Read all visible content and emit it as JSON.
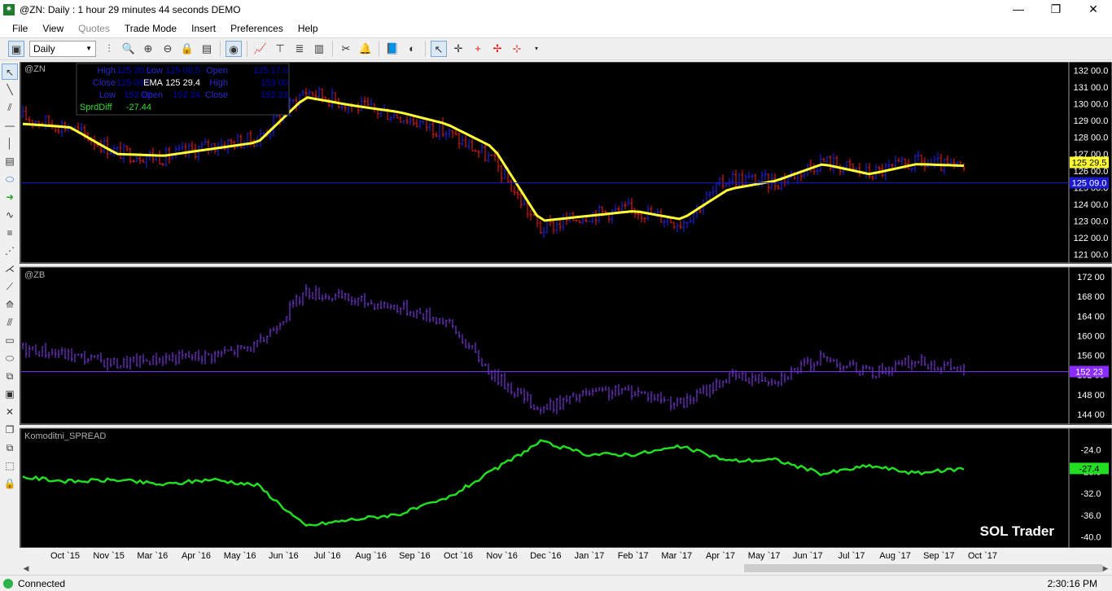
{
  "window": {
    "title": "@ZN: Daily : 1 hour 29 minutes 44 seconds DEMO",
    "min_glyph": "—",
    "max_glyph": "❐",
    "close_glyph": "✕"
  },
  "menu": [
    "File",
    "View",
    "Quotes",
    "Trade Mode",
    "Insert",
    "Preferences",
    "Help"
  ],
  "toolbar": {
    "interval": "Daily"
  },
  "data_window": {
    "rows": [
      [
        "High",
        "125 20.0",
        "Low",
        "125 06.5",
        "Open",
        "125 17.0"
      ],
      [
        "Close",
        "125 09.0",
        "EMA",
        "125 29.4",
        "High",
        "153 00"
      ],
      [
        "Low",
        "152 12",
        "Open",
        "152 24",
        "Close",
        "152 23"
      ],
      [
        "SprdDiff",
        "-27.44"
      ]
    ]
  },
  "panels": {
    "zn": {
      "label": "@ZN",
      "axis_ticks": [
        "132 00.0",
        "131 00.0",
        "130 00.0",
        "129 00.0",
        "128 00.0",
        "127 00.0",
        "126 00.0",
        "125 00.0",
        "124 00.0",
        "123 00.0",
        "122 00.0",
        "121 00.0"
      ],
      "ema_tag": "125 29.5",
      "price_tag": "125 09.0"
    },
    "zb": {
      "label": "@ZB",
      "axis_ticks": [
        "172 00",
        "168 00",
        "164 00",
        "160 00",
        "156 00",
        "152 00",
        "148 00",
        "144 00"
      ],
      "price_tag": "152 23"
    },
    "spread": {
      "label": "Komoditni_SPREAD",
      "axis_ticks": [
        "-24.0",
        "-28.0",
        "-32.0",
        "-36.0",
        "-40.0"
      ],
      "value_tag": "-27.4",
      "watermark": "SOL Trader"
    }
  },
  "x_axis": [
    "Oct `15",
    "Nov `15",
    "Mar `16",
    "Apr `16",
    "May `16",
    "Jun `16",
    "Jul `16",
    "Aug `16",
    "Sep `16",
    "Oct `16",
    "Nov `16",
    "Dec `16",
    "Jan `17",
    "Feb `17",
    "Mar `17",
    "Apr `17",
    "May `17",
    "Jun `17",
    "Jul `17",
    "Aug `17",
    "Sep `17",
    "Oct `17"
  ],
  "status": {
    "connection": "Connected",
    "clock": "2:30:16 PM"
  },
  "colors": {
    "bg": "#000000",
    "up_bar": "#2222ff",
    "down_bar": "#ff1a1a",
    "ema": "#ffff33",
    "zb_bar": "#8a3cff",
    "spread": "#22dd22",
    "hline": "#1a1acc"
  },
  "chart_data": [
    {
      "type": "line",
      "panel": "@ZN",
      "x": [
        "Oct `15",
        "Nov `15",
        "Mar `16",
        "Apr `16",
        "May `16",
        "Jun `16",
        "Jul `16",
        "Aug `16",
        "Sep `16",
        "Oct `16",
        "Nov `16",
        "Dec `16",
        "Jan `17",
        "Feb `17",
        "Mar `17",
        "Apr `17",
        "May `17",
        "Jun `17",
        "Jul `17",
        "Aug `17",
        "Sep `17"
      ],
      "series": [
        {
          "name": "",
          "values": [
            129.2,
            128.6,
            127.1,
            126.8,
            127.5,
            127.9,
            130.8,
            129.9,
            129.3,
            128.3,
            126.6,
            122.5,
            123.4,
            123.7,
            122.9,
            125.6,
            125.3,
            126.6,
            125.8,
            126.5,
            126.1
          ]
        },
        {
          "name": "EMA",
          "values": [
            128.8,
            128.6,
            127.0,
            126.9,
            127.3,
            127.7,
            130.4,
            129.9,
            129.5,
            128.8,
            127.4,
            123.0,
            123.3,
            123.6,
            123.1,
            124.9,
            125.4,
            126.4,
            125.8,
            126.4,
            126.3
          ]
        }
      ],
      "ylim": [
        120.5,
        132.5
      ]
    },
    {
      "type": "line",
      "panel": "@ZB",
      "x": [
        "Oct `15",
        "Nov `15",
        "Mar `16",
        "Apr `16",
        "May `16",
        "Jun `16",
        "Jul `16",
        "Aug `16",
        "Sep `16",
        "Oct `16",
        "Nov `16",
        "Dec `16",
        "Jan `17",
        "Feb `17",
        "Mar `17",
        "Apr `17",
        "May `17",
        "Jun `17",
        "Jul `17",
        "Aug `17",
        "Sep `17"
      ],
      "series": [
        {
          "name": "",
          "values": [
            157.5,
            156.0,
            154.3,
            155.4,
            156.0,
            158.0,
            169.0,
            167.3,
            165.8,
            163.0,
            152.0,
            145.0,
            148.2,
            148.8,
            146.0,
            151.6,
            151.3,
            155.5,
            152.4,
            154.8,
            153.0
          ]
        }
      ],
      "ylim": [
        142,
        174
      ]
    },
    {
      "type": "line",
      "panel": "Komoditni_SPREAD",
      "x": [
        "Oct `15",
        "Nov `15",
        "Mar `16",
        "Apr `16",
        "May `16",
        "Jun `16",
        "Jul `16",
        "Aug `16",
        "Sep `16",
        "Oct `16",
        "Nov `16",
        "Dec `16",
        "Jan `17",
        "Feb `17",
        "Mar `17",
        "Apr `17",
        "May `17",
        "Jun `17",
        "Jul `17",
        "Aug `17",
        "Sep `17"
      ],
      "series": [
        {
          "name": "",
          "values": [
            -29.0,
            -29.8,
            -29.5,
            -30.4,
            -29.4,
            -30.5,
            -38.0,
            -36.8,
            -35.8,
            -33.0,
            -27.8,
            -22.5,
            -24.8,
            -24.8,
            -23.4,
            -26.0,
            -25.8,
            -28.4,
            -26.9,
            -28.3,
            -27.4
          ]
        }
      ],
      "ylim": [
        -42,
        -20
      ]
    }
  ]
}
